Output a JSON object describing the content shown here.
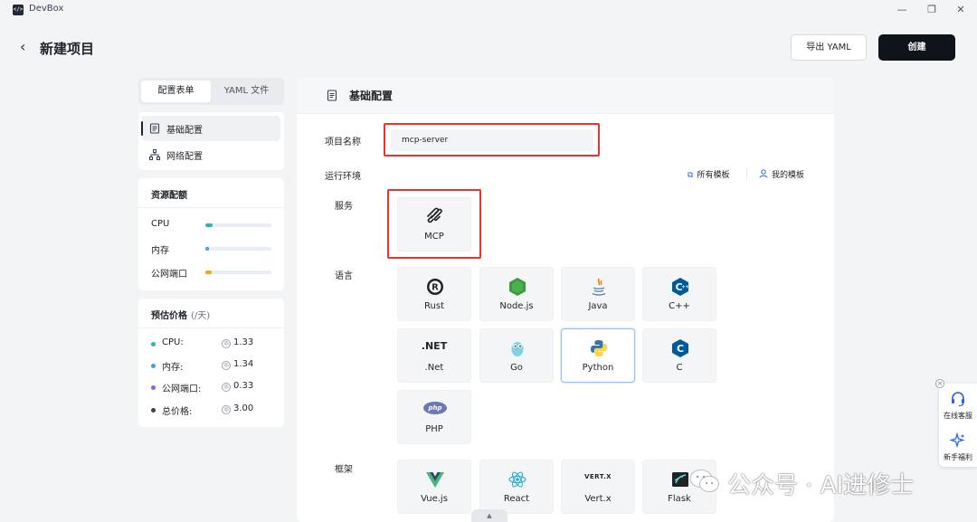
{
  "window": {
    "app_title": "DevBox",
    "logo_glyph": "</>",
    "minimize": "—",
    "restore": "❐",
    "close": "✕"
  },
  "header": {
    "back_icon": "‹",
    "title": "新建项目",
    "export_label": "导出 YAML",
    "create_label": "创建"
  },
  "tabs": [
    {
      "label": "配置表单",
      "active": true
    },
    {
      "label": "YAML 文件",
      "active": false
    }
  ],
  "nav": [
    {
      "label": "基础配置",
      "icon": "document-icon",
      "active": true
    },
    {
      "label": "网络配置",
      "icon": "network-icon",
      "active": false
    }
  ],
  "resources": {
    "title": "资源配额",
    "items": [
      {
        "label": "CPU",
        "fill": 0.11,
        "color": "#2bb7b0"
      },
      {
        "label": "内存",
        "fill": 0.05,
        "color": "#3b9fe0"
      },
      {
        "label": "公网端口",
        "fill": 0.1,
        "color": "#f5a623"
      }
    ]
  },
  "price": {
    "title": "预估价格",
    "unit": "(/天)",
    "coin_glyph": "◎",
    "items": [
      {
        "label": "CPU:",
        "value": "1.33",
        "color": "#2bb7b0"
      },
      {
        "label": "内存:",
        "value": "1.34",
        "color": "#3b9fe0"
      },
      {
        "label": "公网端口:",
        "value": "0.33",
        "color": "#8b5cf6"
      },
      {
        "label": "总价格:",
        "value": "3.00",
        "color": "#374151"
      }
    ]
  },
  "main": {
    "section_title": "基础配置",
    "project_name_label": "项目名称",
    "project_name_value": "mcp-server",
    "runtime_label": "运行环境",
    "all_templates": "所有模板",
    "my_templates": "我的模板",
    "service_label": "服务",
    "language_label": "语言",
    "framework_label": "框架",
    "services": [
      {
        "label": "MCP",
        "icon": "mcp-icon"
      }
    ],
    "languages": [
      {
        "label": "Rust",
        "icon": "rust-icon"
      },
      {
        "label": "Node.js",
        "icon": "nodejs-icon"
      },
      {
        "label": "Java",
        "icon": "java-icon"
      },
      {
        "label": "C++",
        "icon": "cpp-icon"
      },
      {
        "label": ".Net",
        "icon": "dotnet-icon",
        "icon_text": ".NET"
      },
      {
        "label": "Go",
        "icon": "go-icon"
      },
      {
        "label": "Python",
        "icon": "python-icon",
        "selected": true
      },
      {
        "label": "C",
        "icon": "c-icon"
      },
      {
        "label": "PHP",
        "icon": "php-icon",
        "icon_text": "php"
      }
    ],
    "frameworks": [
      {
        "label": "Vue.js",
        "icon": "vue-icon"
      },
      {
        "label": "React",
        "icon": "react-icon"
      },
      {
        "label": "Vert.x",
        "icon": "vertx-icon",
        "icon_text": "VERT.X"
      },
      {
        "label": "Flask",
        "icon": "flask-icon"
      }
    ]
  },
  "float_widget": {
    "close_glyph": "×",
    "items": [
      {
        "label": "在线客服",
        "icon": "headset-icon"
      },
      {
        "label": "新手福利",
        "icon": "sparkle-icon"
      }
    ]
  },
  "scroll_handle_glyph": "▲",
  "watermark": "公众号 · AI进修士"
}
